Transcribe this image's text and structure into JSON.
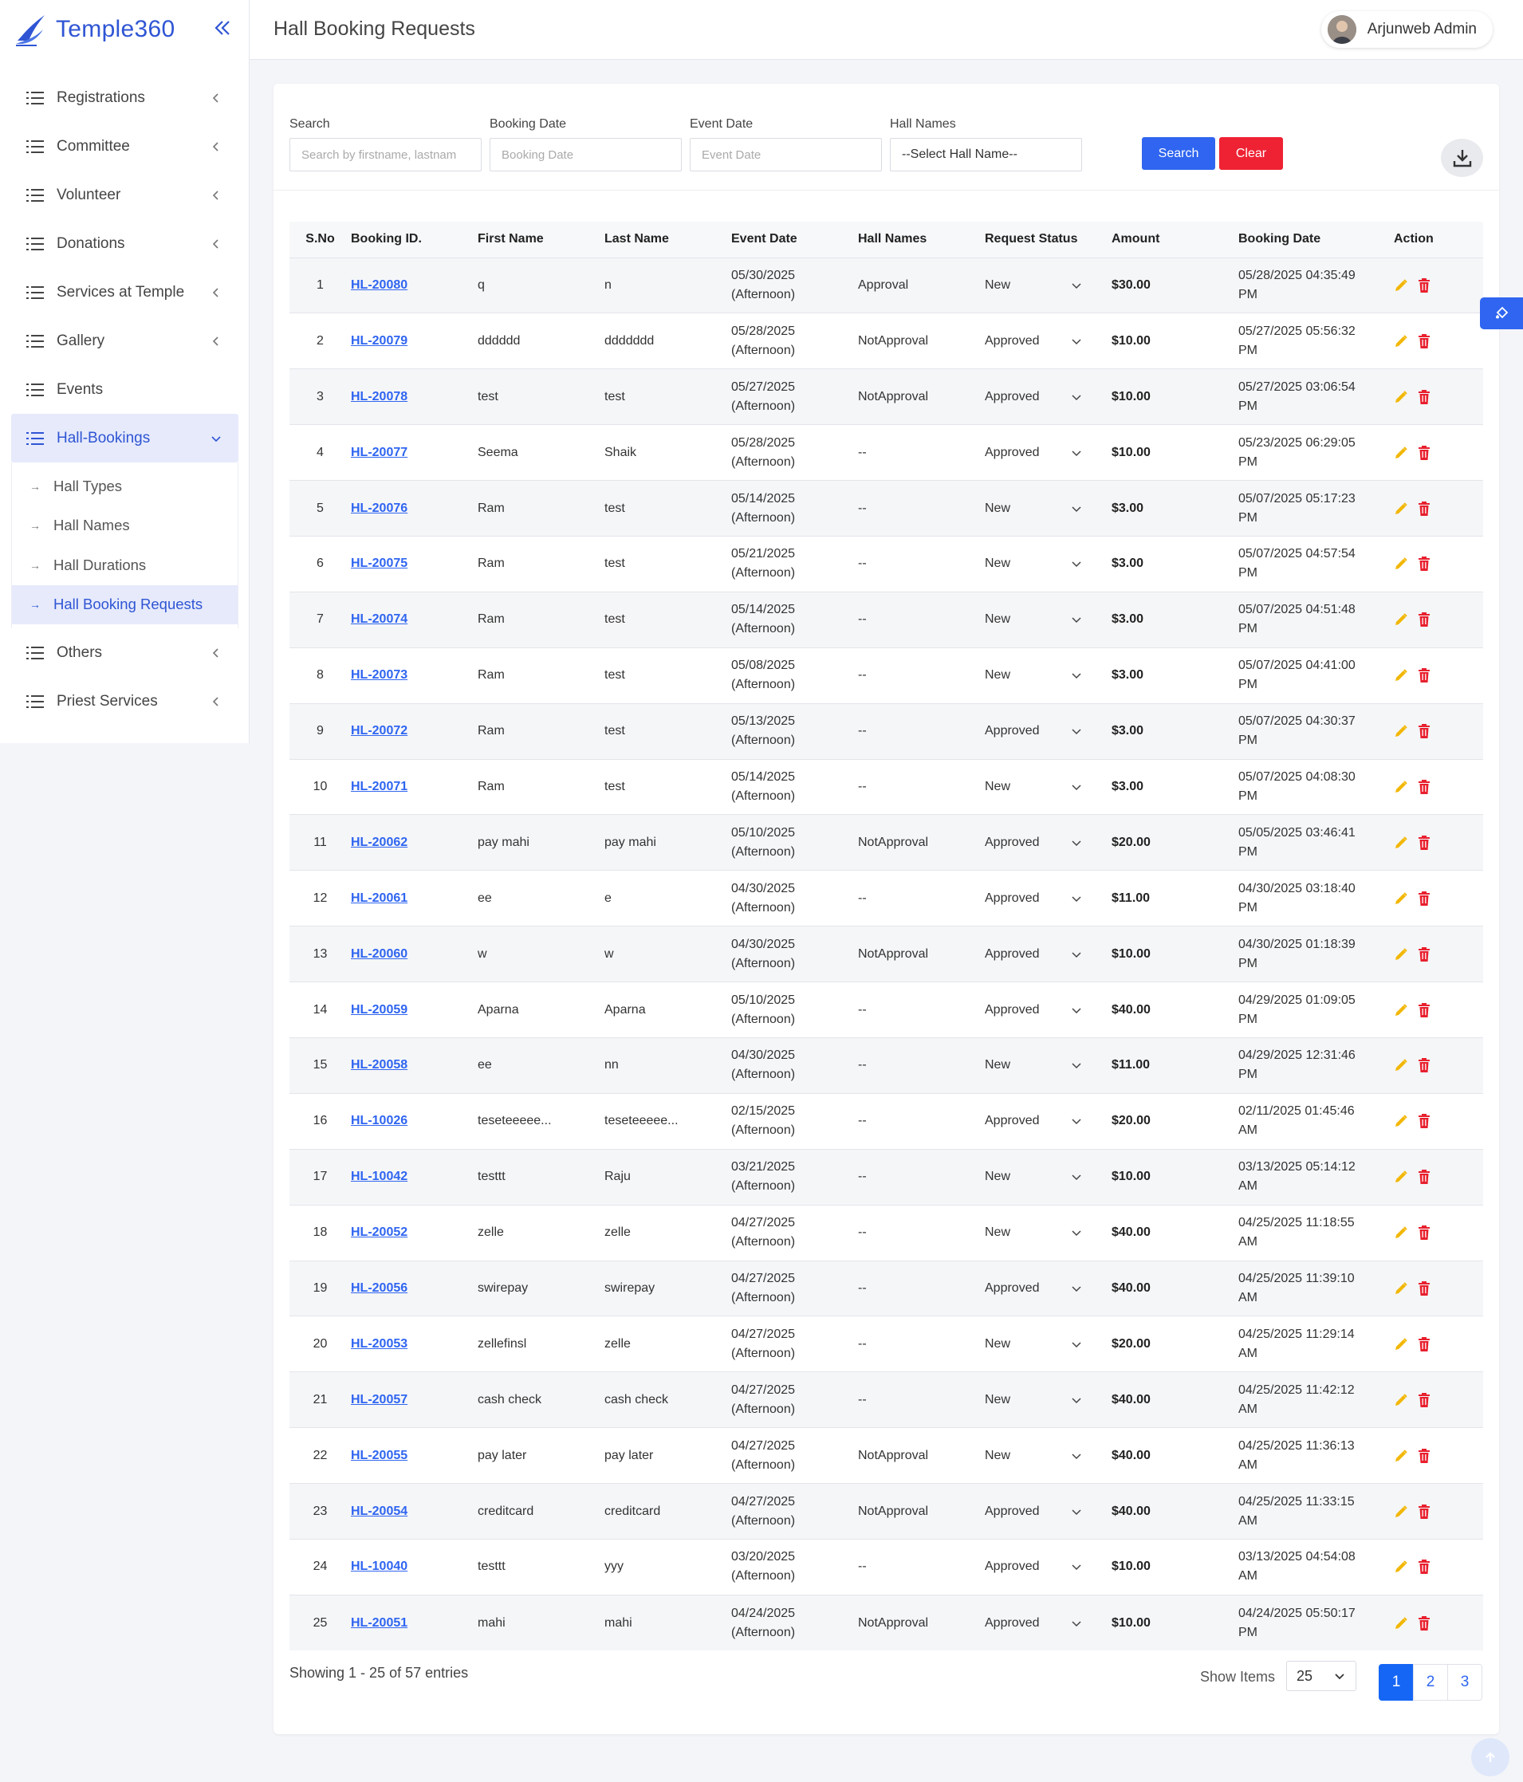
{
  "brand": {
    "name": "Temple360"
  },
  "colors": {
    "primary": "#2f55d4",
    "search_button": "#2f65f0",
    "clear_button": "#ee2233",
    "edit_icon": "#f2b705",
    "delete_icon": "#e8202e"
  },
  "sidebar": {
    "items": [
      {
        "label": "Registrations",
        "icon": "list-icon",
        "expandable": true
      },
      {
        "label": "Committee",
        "icon": "list-icon",
        "expandable": true
      },
      {
        "label": "Volunteer",
        "icon": "list-icon",
        "expandable": true
      },
      {
        "label": "Donations",
        "icon": "list-icon",
        "expandable": true
      },
      {
        "label": "Services at Temple",
        "icon": "list-icon",
        "expandable": true
      },
      {
        "label": "Gallery",
        "icon": "list-icon",
        "expandable": true
      },
      {
        "label": "Events",
        "icon": "list-icon",
        "expandable": false
      },
      {
        "label": "Hall-Bookings",
        "icon": "list-icon",
        "expandable": true,
        "active": true
      },
      {
        "label": "Others",
        "icon": "list-icon",
        "expandable": true
      },
      {
        "label": "Priest Services",
        "icon": "list-icon",
        "expandable": true
      }
    ],
    "sub_items": [
      {
        "label": "Hall Types"
      },
      {
        "label": "Hall Names"
      },
      {
        "label": "Hall Durations"
      },
      {
        "label": "Hall Booking Requests",
        "active": true
      }
    ]
  },
  "header": {
    "title": "Hall Booking Requests",
    "user_name": "Arjunweb Admin"
  },
  "filters": {
    "search_label": "Search",
    "search_placeholder": "Search by firstname, lastnam",
    "booking_date_label": "Booking Date",
    "booking_date_placeholder": "Booking Date",
    "event_date_label": "Event Date",
    "event_date_placeholder": "Event Date",
    "hall_names_label": "Hall Names",
    "hall_names_value": "--Select Hall Name--",
    "search_button": "Search",
    "clear_button": "Clear"
  },
  "table": {
    "columns": [
      "S.No",
      "Booking ID.",
      "First Name",
      "Last Name",
      "Event Date",
      "Hall Names",
      "Request Status",
      "Amount",
      "Booking Date",
      "Action"
    ],
    "rows": [
      {
        "sno": "1",
        "id": "HL-20080",
        "first": "q",
        "last": "n",
        "event_date": "05/30/2025",
        "event_slot": "(Afternoon)",
        "hall": "Approval",
        "status": "New",
        "amount": "$30.00",
        "booking_date": "05/28/2025 04:35:49",
        "booking_ampm": "PM"
      },
      {
        "sno": "2",
        "id": "HL-20079",
        "first": "dddddd",
        "last": "ddddddd",
        "event_date": "05/28/2025",
        "event_slot": "(Afternoon)",
        "hall": "NotApproval",
        "status": "Approved",
        "amount": "$10.00",
        "booking_date": "05/27/2025 05:56:32",
        "booking_ampm": "PM"
      },
      {
        "sno": "3",
        "id": "HL-20078",
        "first": "test",
        "last": "test",
        "event_date": "05/27/2025",
        "event_slot": "(Afternoon)",
        "hall": "NotApproval",
        "status": "Approved",
        "amount": "$10.00",
        "booking_date": "05/27/2025 03:06:54",
        "booking_ampm": "PM"
      },
      {
        "sno": "4",
        "id": "HL-20077",
        "first": "Seema",
        "last": "Shaik",
        "event_date": "05/28/2025",
        "event_slot": "(Afternoon)",
        "hall": "--",
        "status": "Approved",
        "amount": "$10.00",
        "booking_date": "05/23/2025 06:29:05",
        "booking_ampm": "PM"
      },
      {
        "sno": "5",
        "id": "HL-20076",
        "first": "Ram",
        "last": "test",
        "event_date": "05/14/2025",
        "event_slot": "(Afternoon)",
        "hall": "--",
        "status": "New",
        "amount": "$3.00",
        "booking_date": "05/07/2025 05:17:23",
        "booking_ampm": "PM"
      },
      {
        "sno": "6",
        "id": "HL-20075",
        "first": "Ram",
        "last": "test",
        "event_date": "05/21/2025",
        "event_slot": "(Afternoon)",
        "hall": "--",
        "status": "New",
        "amount": "$3.00",
        "booking_date": "05/07/2025 04:57:54",
        "booking_ampm": "PM"
      },
      {
        "sno": "7",
        "id": "HL-20074",
        "first": "Ram",
        "last": "test",
        "event_date": "05/14/2025",
        "event_slot": "(Afternoon)",
        "hall": "--",
        "status": "New",
        "amount": "$3.00",
        "booking_date": "05/07/2025 04:51:48",
        "booking_ampm": "PM"
      },
      {
        "sno": "8",
        "id": "HL-20073",
        "first": "Ram",
        "last": "test",
        "event_date": "05/08/2025",
        "event_slot": "(Afternoon)",
        "hall": "--",
        "status": "New",
        "amount": "$3.00",
        "booking_date": "05/07/2025 04:41:00",
        "booking_ampm": "PM"
      },
      {
        "sno": "9",
        "id": "HL-20072",
        "first": "Ram",
        "last": "test",
        "event_date": "05/13/2025",
        "event_slot": "(Afternoon)",
        "hall": "--",
        "status": "Approved",
        "amount": "$3.00",
        "booking_date": "05/07/2025 04:30:37",
        "booking_ampm": "PM"
      },
      {
        "sno": "10",
        "id": "HL-20071",
        "first": "Ram",
        "last": "test",
        "event_date": "05/14/2025",
        "event_slot": "(Afternoon)",
        "hall": "--",
        "status": "New",
        "amount": "$3.00",
        "booking_date": "05/07/2025 04:08:30",
        "booking_ampm": "PM"
      },
      {
        "sno": "11",
        "id": "HL-20062",
        "first": "pay mahi",
        "last": "pay mahi",
        "event_date": "05/10/2025",
        "event_slot": "(Afternoon)",
        "hall": "NotApproval",
        "status": "Approved",
        "amount": "$20.00",
        "booking_date": "05/05/2025 03:46:41",
        "booking_ampm": "PM"
      },
      {
        "sno": "12",
        "id": "HL-20061",
        "first": "ee",
        "last": "e",
        "event_date": "04/30/2025",
        "event_slot": "(Afternoon)",
        "hall": "--",
        "status": "Approved",
        "amount": "$11.00",
        "booking_date": "04/30/2025 03:18:40",
        "booking_ampm": "PM"
      },
      {
        "sno": "13",
        "id": "HL-20060",
        "first": "w",
        "last": "w",
        "event_date": "04/30/2025",
        "event_slot": "(Afternoon)",
        "hall": "NotApproval",
        "status": "Approved",
        "amount": "$10.00",
        "booking_date": "04/30/2025 01:18:39",
        "booking_ampm": "PM"
      },
      {
        "sno": "14",
        "id": "HL-20059",
        "first": "Aparna",
        "last": "Aparna",
        "event_date": "05/10/2025",
        "event_slot": "(Afternoon)",
        "hall": "--",
        "status": "Approved",
        "amount": "$40.00",
        "booking_date": "04/29/2025 01:09:05",
        "booking_ampm": "PM"
      },
      {
        "sno": "15",
        "id": "HL-20058",
        "first": "ee",
        "last": "nn",
        "event_date": "04/30/2025",
        "event_slot": "(Afternoon)",
        "hall": "--",
        "status": "New",
        "amount": "$11.00",
        "booking_date": "04/29/2025 12:31:46",
        "booking_ampm": "PM"
      },
      {
        "sno": "16",
        "id": "HL-10026",
        "first": "teseteeeee...",
        "last": "teseteeeee...",
        "event_date": "02/15/2025",
        "event_slot": "(Afternoon)",
        "hall": "--",
        "status": "Approved",
        "amount": "$20.00",
        "booking_date": "02/11/2025 01:45:46",
        "booking_ampm": "AM"
      },
      {
        "sno": "17",
        "id": "HL-10042",
        "first": "testtt",
        "last": "Raju",
        "event_date": "03/21/2025",
        "event_slot": "(Afternoon)",
        "hall": "--",
        "status": "New",
        "amount": "$10.00",
        "booking_date": "03/13/2025 05:14:12",
        "booking_ampm": "AM"
      },
      {
        "sno": "18",
        "id": "HL-20052",
        "first": "zelle",
        "last": "zelle",
        "event_date": "04/27/2025",
        "event_slot": "(Afternoon)",
        "hall": "--",
        "status": "New",
        "amount": "$40.00",
        "booking_date": "04/25/2025 11:18:55",
        "booking_ampm": "AM"
      },
      {
        "sno": "19",
        "id": "HL-20056",
        "first": "swirepay",
        "last": "swirepay",
        "event_date": "04/27/2025",
        "event_slot": "(Afternoon)",
        "hall": "--",
        "status": "Approved",
        "amount": "$40.00",
        "booking_date": "04/25/2025 11:39:10",
        "booking_ampm": "AM"
      },
      {
        "sno": "20",
        "id": "HL-20053",
        "first": "zellefinsl",
        "last": "zelle",
        "event_date": "04/27/2025",
        "event_slot": "(Afternoon)",
        "hall": "--",
        "status": "New",
        "amount": "$20.00",
        "booking_date": "04/25/2025 11:29:14",
        "booking_ampm": "AM"
      },
      {
        "sno": "21",
        "id": "HL-20057",
        "first": "cash check",
        "last": "cash check",
        "event_date": "04/27/2025",
        "event_slot": "(Afternoon)",
        "hall": "--",
        "status": "New",
        "amount": "$40.00",
        "booking_date": "04/25/2025 11:42:12",
        "booking_ampm": "AM"
      },
      {
        "sno": "22",
        "id": "HL-20055",
        "first": "pay later",
        "last": "pay later",
        "event_date": "04/27/2025",
        "event_slot": "(Afternoon)",
        "hall": "NotApproval",
        "status": "New",
        "amount": "$40.00",
        "booking_date": "04/25/2025 11:36:13",
        "booking_ampm": "AM"
      },
      {
        "sno": "23",
        "id": "HL-20054",
        "first": "creditcard",
        "last": "creditcard",
        "event_date": "04/27/2025",
        "event_slot": "(Afternoon)",
        "hall": "NotApproval",
        "status": "Approved",
        "amount": "$40.00",
        "booking_date": "04/25/2025 11:33:15",
        "booking_ampm": "AM"
      },
      {
        "sno": "24",
        "id": "HL-10040",
        "first": "testtt",
        "last": "yyy",
        "event_date": "03/20/2025",
        "event_slot": "(Afternoon)",
        "hall": "--",
        "status": "Approved",
        "amount": "$10.00",
        "booking_date": "03/13/2025 04:54:08",
        "booking_ampm": "AM"
      },
      {
        "sno": "25",
        "id": "HL-20051",
        "first": "mahi",
        "last": "mahi",
        "event_date": "04/24/2025",
        "event_slot": "(Afternoon)",
        "hall": "NotApproval",
        "status": "Approved",
        "amount": "$10.00",
        "booking_date": "04/24/2025 05:50:17",
        "booking_ampm": "PM"
      }
    ]
  },
  "footer": {
    "showing_text": "Showing 1 - 25 of 57 entries",
    "show_items_label": "Show Items",
    "show_items_value": "25",
    "pages": [
      "1",
      "2",
      "3"
    ],
    "current_page": "1"
  }
}
